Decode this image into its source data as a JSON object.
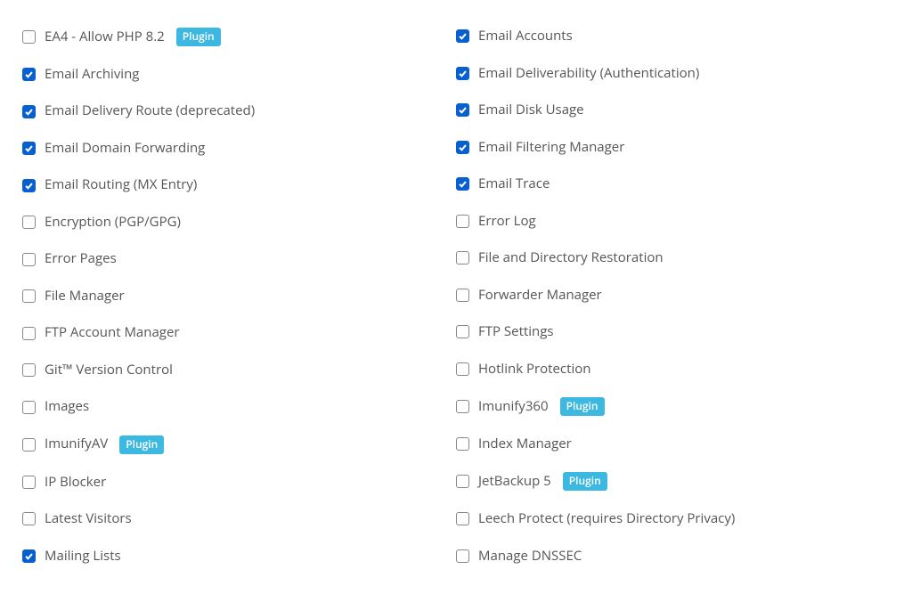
{
  "badge_label": "Plugin",
  "columns": [
    [
      {
        "label": "EA4 - Allow PHP 8.2",
        "checked": false,
        "plugin": true
      },
      {
        "label": "Email Archiving",
        "checked": true,
        "plugin": false
      },
      {
        "label": "Email Delivery Route (deprecated)",
        "checked": true,
        "plugin": false
      },
      {
        "label": "Email Domain Forwarding",
        "checked": true,
        "plugin": false
      },
      {
        "label": "Email Routing (MX Entry)",
        "checked": true,
        "plugin": false
      },
      {
        "label": "Encryption (PGP/GPG)",
        "checked": false,
        "plugin": false
      },
      {
        "label": "Error Pages",
        "checked": false,
        "plugin": false
      },
      {
        "label": "File Manager",
        "checked": false,
        "plugin": false
      },
      {
        "label": "FTP Account Manager",
        "checked": false,
        "plugin": false
      },
      {
        "label": "Git™ Version Control",
        "checked": false,
        "plugin": false
      },
      {
        "label": "Images",
        "checked": false,
        "plugin": false
      },
      {
        "label": "ImunifyAV",
        "checked": false,
        "plugin": true
      },
      {
        "label": "IP Blocker",
        "checked": false,
        "plugin": false
      },
      {
        "label": "Latest Visitors",
        "checked": false,
        "plugin": false
      },
      {
        "label": "Mailing Lists",
        "checked": true,
        "plugin": false
      }
    ],
    [
      {
        "label": "Email Accounts",
        "checked": true,
        "plugin": false
      },
      {
        "label": "Email Deliverability (Authentication)",
        "checked": true,
        "plugin": false
      },
      {
        "label": "Email Disk Usage",
        "checked": true,
        "plugin": false
      },
      {
        "label": "Email Filtering Manager",
        "checked": true,
        "plugin": false
      },
      {
        "label": "Email Trace",
        "checked": true,
        "plugin": false
      },
      {
        "label": "Error Log",
        "checked": false,
        "plugin": false
      },
      {
        "label": "File and Directory Restoration",
        "checked": false,
        "plugin": false
      },
      {
        "label": "Forwarder Manager",
        "checked": false,
        "plugin": false
      },
      {
        "label": "FTP Settings",
        "checked": false,
        "plugin": false
      },
      {
        "label": "Hotlink Protection",
        "checked": false,
        "plugin": false
      },
      {
        "label": "Imunify360",
        "checked": false,
        "plugin": true
      },
      {
        "label": "Index Manager",
        "checked": false,
        "plugin": false
      },
      {
        "label": "JetBackup 5",
        "checked": false,
        "plugin": true
      },
      {
        "label": "Leech Protect (requires Directory Privacy)",
        "checked": false,
        "plugin": false
      },
      {
        "label": "Manage DNSSEC",
        "checked": false,
        "plugin": false
      }
    ]
  ]
}
